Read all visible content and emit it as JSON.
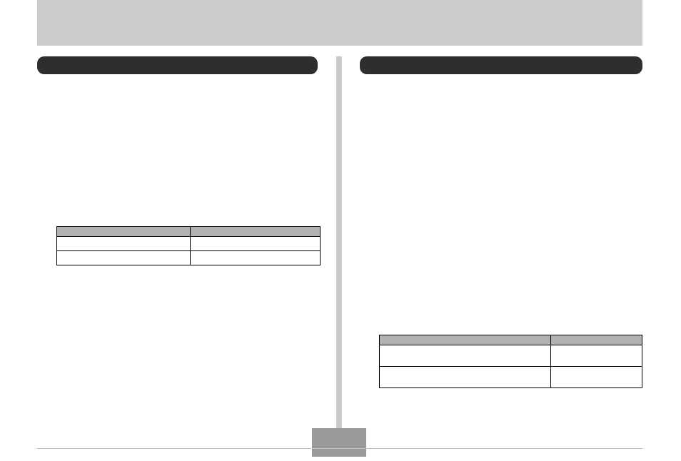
{
  "header": {
    "title": ""
  },
  "left": {
    "pill_label": "",
    "table": {
      "headers": [
        "",
        ""
      ],
      "rows": [
        [
          "",
          ""
        ],
        [
          "",
          ""
        ]
      ]
    }
  },
  "right": {
    "pill_label": "",
    "table": {
      "headers": [
        "",
        ""
      ],
      "rows": [
        [
          "",
          ""
        ],
        [
          "",
          ""
        ]
      ]
    }
  },
  "footer": {
    "page_number": ""
  }
}
